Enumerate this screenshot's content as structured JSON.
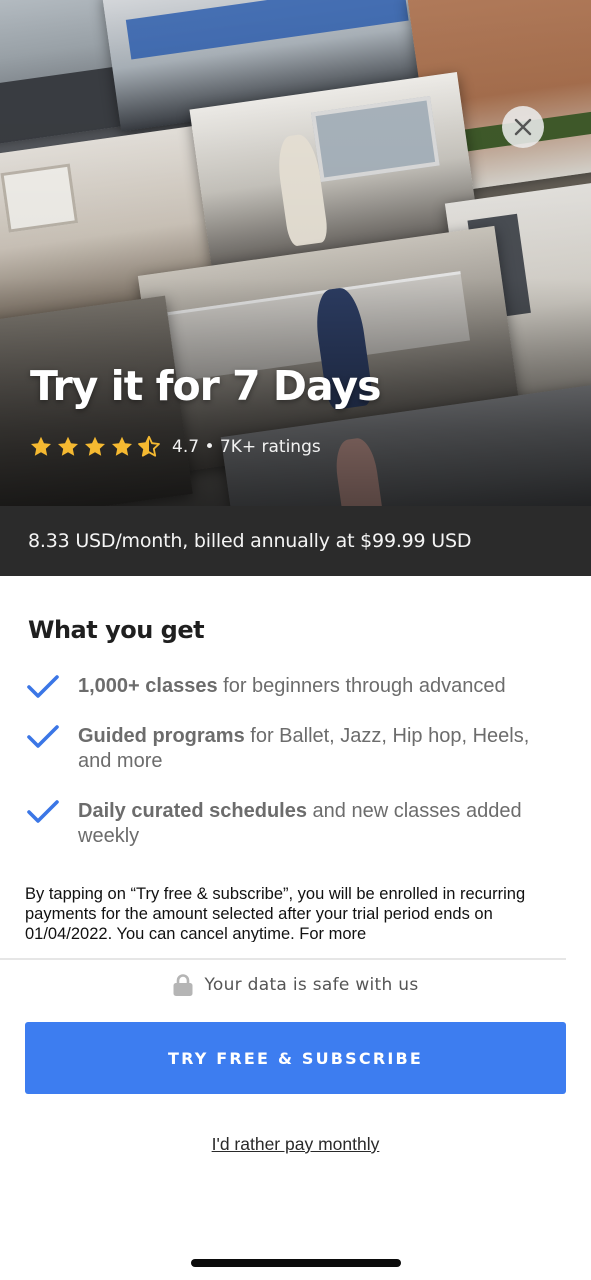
{
  "hero": {
    "title": "Try it for 7 Days",
    "rating_value": "4.7",
    "rating_count": "7K+ ratings",
    "rating_stars": 4.5,
    "star_color": "#f5b931",
    "close_icon": "close-icon"
  },
  "pricing": {
    "text": "8.33 USD/month, billed annually at $99.99 USD"
  },
  "benefits": {
    "title": "What you get",
    "items": [
      {
        "bold": "1,000+ classes",
        "rest": " for beginners through advanced"
      },
      {
        "bold": "Guided programs",
        "rest": " for Ballet, Jazz, Hip hop, Heels, and more"
      },
      {
        "bold": "Daily curated schedules",
        "rest": " and new classes added weekly"
      }
    ],
    "check_icon": "checkmark-icon",
    "check_color": "#3b76e6"
  },
  "legal": {
    "text": "By tapping on “Try free & subscribe”, you will be enrolled in recurring payments for the amount selected after your trial period ends on 01/04/2022. You can cancel anytime. For more"
  },
  "security": {
    "text": "Your data is safe with us",
    "icon": "lock-icon"
  },
  "cta": {
    "label": "TRY FREE & SUBSCRIBE",
    "color": "#3d7df0"
  },
  "alt_option": {
    "label": "I'd rather pay monthly"
  }
}
